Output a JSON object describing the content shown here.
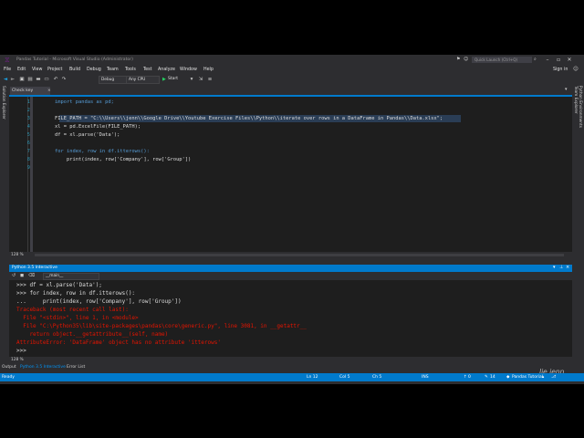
{
  "window": {
    "title": "Pandas Tutorial - Microsoft Visual Studio (Administrator)",
    "quick_launch": "Quick Launch (Ctrl+Q)"
  },
  "menu": [
    "File",
    "Edit",
    "View",
    "Project",
    "Build",
    "Debug",
    "Team",
    "Tools",
    "Test",
    "Analyze",
    "Window",
    "Help"
  ],
  "signin": "Sign in",
  "toolbar": {
    "config": "Debug",
    "platform": "Any CPU",
    "start": "Start"
  },
  "side_tabs": {
    "left": "Solution Explorer",
    "right": [
      "Team Explorer",
      "Python Environments"
    ]
  },
  "doc_tab": "Check key exist.py*",
  "editor": {
    "lines": [
      {
        "n": "1",
        "text": "import pandas as pd;"
      },
      {
        "n": "2",
        "text": ""
      },
      {
        "n": "3",
        "text": "FILE_PATH = \"C:\\\\Users\\\\jenn\\\\Google Drive\\\\Youtube Exercise Files\\\\Python\\\\iterate over rows in a DataFrame in Pandas\\\\Data.xlsx\";"
      },
      {
        "n": "4",
        "text": "xl = pd.ExcelFile(FILE_PATH);"
      },
      {
        "n": "5",
        "text": "df = xl.parse('Data');"
      },
      {
        "n": "6",
        "text": ""
      },
      {
        "n": "7",
        "text": "for index, row in df.itterows():"
      },
      {
        "n": "8",
        "text": "    print(index, row['Company'], row['Group'])"
      },
      {
        "n": "9",
        "text": ""
      }
    ],
    "zoom": "128 %"
  },
  "interactive": {
    "title": "Python 3.5 Interactive",
    "scope": "__main__",
    "lines": [
      {
        "text": ">>> df = xl.parse('Data');",
        "kind": "white"
      },
      {
        "text": ">>> for index, row in df.itterows():",
        "kind": "white"
      },
      {
        "text": "...     print(index, row['Company'], row['Group'])",
        "kind": "white"
      },
      {
        "text": "Traceback (most recent call last):",
        "kind": "red"
      },
      {
        "text": "  File \"<stdin>\", line 1, in <module>",
        "kind": "red"
      },
      {
        "text": "  File \"C:\\Python35\\lib\\site-packages\\pandas\\core\\generic.py\", line 3081, in __getattr__",
        "kind": "red"
      },
      {
        "text": "    return object.__getattribute__(self, name)",
        "kind": "red"
      },
      {
        "text": "AttributeError: 'DataFrame' object has no attribute 'itterows'",
        "kind": "red"
      },
      {
        "text": ">>>",
        "kind": "white"
      }
    ],
    "zoom": "128 %"
  },
  "output_tabs": [
    "Output",
    "Python 3.5 Interactive",
    "Error List"
  ],
  "status": {
    "ready": "Ready",
    "ln": "Ln 12",
    "col": "Col 5",
    "ch": "Ch 5",
    "ins": "INS",
    "up": "0",
    "pencil": "14",
    "project": "Pandas Tutorial"
  },
  "watermark": "lie jenn",
  "colors": {
    "accent": "#007acc",
    "background": "#2d2d30",
    "editor": "#1e1e1e",
    "error": "#e51400"
  }
}
